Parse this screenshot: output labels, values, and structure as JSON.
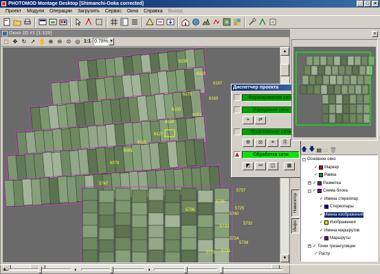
{
  "window": {
    "title": "PHOTOMOD Montage Desktop [Shimanchi-Ooka corrected]",
    "minimize": "_",
    "maximize": "□",
    "close": "×"
  },
  "menu": [
    "Проект",
    "Модули",
    "Операции",
    "Загрузить",
    "Сервис",
    "Окна",
    "Справка",
    "Выход"
  ],
  "child_window": {
    "title": "Окно 2D #1 [1:129]",
    "zoom_value": "0.78%",
    "zoom_label": "1:1"
  },
  "canvas": {
    "image_labels": [
      {
        "text": "6235"
      },
      {
        "text": "6223"
      },
      {
        "text": "6187"
      },
      {
        "text": "6163"
      },
      {
        "text": "6175"
      },
      {
        "text": "6151"
      },
      {
        "text": "6103"
      },
      {
        "text": "6139"
      },
      {
        "text": "6127"
      },
      {
        "text": "6115"
      },
      {
        "text": "6091"
      },
      {
        "text": "6079"
      },
      {
        "text": "5747"
      },
      {
        "text": "5735"
      },
      {
        "text": "5740"
      },
      {
        "text": "5733"
      },
      {
        "text": "5734"
      },
      {
        "text": "5731"
      },
      {
        "text": "5737"
      },
      {
        "text": "5725"
      },
      {
        "text": "5732"
      },
      {
        "text": "5738"
      },
      {
        "text": "5739"
      },
      {
        "text": "5736"
      }
    ]
  },
  "dispatcher": {
    "title": "Диспетчер проекта",
    "close": "×",
    "stages": [
      {
        "label": "Формирование сети",
        "state": "off",
        "indicator": "normal"
      },
      {
        "label": "Измерение сети",
        "state": "off",
        "indicator": "normal"
      },
      {
        "label": "Уравнивание сети",
        "state": "off",
        "indicator": "normal"
      },
      {
        "label": "Обработка сети",
        "state": "on",
        "indicator": "warn"
      }
    ]
  },
  "layers": {
    "items": [
      {
        "label": "Основное окно",
        "level": 0,
        "expand": "-",
        "swatch": ""
      },
      {
        "label": "Маркер",
        "level": 1,
        "expand": "",
        "swatch": "#d00000"
      },
      {
        "label": "Рамка",
        "level": 1,
        "expand": "",
        "swatch": "#00a000"
      },
      {
        "label": "Разметка",
        "level": 1,
        "expand": "+",
        "swatch": "#8000a0"
      },
      {
        "label": "Схема блока",
        "level": 1,
        "expand": "-",
        "swatch": "#8000a0"
      },
      {
        "label": "Имена стереопар",
        "level": 2,
        "expand": "",
        "swatch": ""
      },
      {
        "label": "Стереопары",
        "level": 2,
        "expand": "",
        "swatch": "#0000c0"
      },
      {
        "label": "Имена изображений",
        "level": 2,
        "expand": "",
        "swatch": "",
        "selected": true
      },
      {
        "label": "Изображения",
        "level": 2,
        "expand": "",
        "swatch": "#f0f000"
      },
      {
        "label": "Имена маршрутов",
        "level": 2,
        "expand": "",
        "swatch": ""
      },
      {
        "label": "Маршруты",
        "level": 2,
        "expand": "",
        "swatch": "#8000a0"
      },
      {
        "label": "Точки триангуляции",
        "level": 1,
        "expand": "+",
        "swatch": ""
      },
      {
        "label": "Растр",
        "level": 1,
        "expand": "",
        "swatch": ""
      }
    ],
    "tabs": [
      "Инфо",
      "Навигатор"
    ]
  }
}
